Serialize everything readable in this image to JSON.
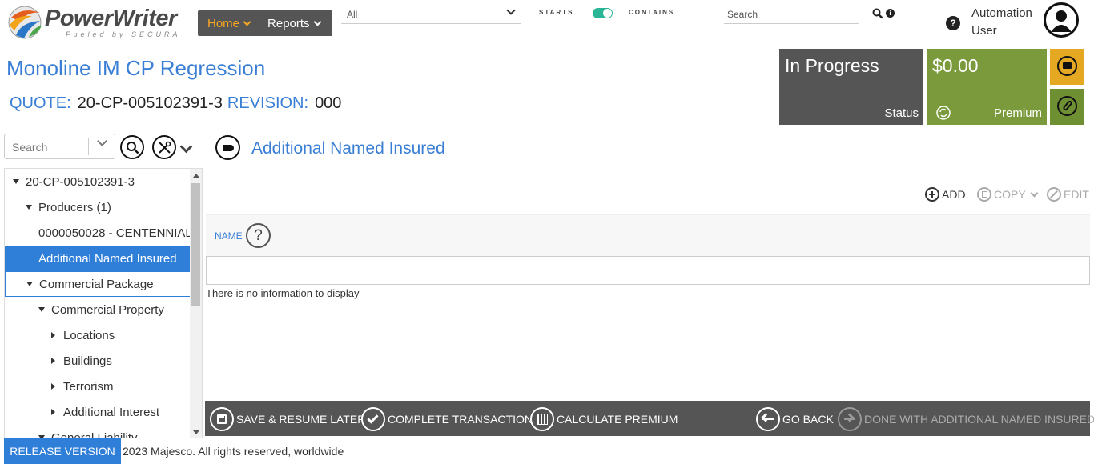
{
  "header": {
    "logo_text": "PowerWriter",
    "logo_tagline": "Fueled by SECURA",
    "nav": [
      {
        "label": "Home"
      },
      {
        "label": "Reports"
      }
    ],
    "scope_select_value": "All",
    "starts_label": "STARTS",
    "contains_label": "CONTAINS",
    "search_placeholder": "Search",
    "help_icon_text": "?",
    "info_icon_text": "i",
    "user": {
      "line1": "Automation",
      "line2": "User"
    }
  },
  "page": {
    "title": "Monoline IM CP Regression",
    "quote_label": "QUOTE:",
    "quote_value": "20-CP-005102391-3",
    "revision_label": "REVISION:",
    "revision_value": "000"
  },
  "tiles": {
    "status_value": "In Progress",
    "status_label": "Status",
    "premium_value": "$0.00",
    "premium_label": "Premium"
  },
  "tree_search": {
    "placeholder": "Search"
  },
  "tree": [
    {
      "label": "20-CP-005102391-3",
      "caret": "down",
      "level": 0
    },
    {
      "label": "Producers (1)",
      "caret": "down",
      "level": 1
    },
    {
      "label": "0000050028 - CENTENNIAL",
      "caret": "none",
      "level": 2
    },
    {
      "label": "Additional Named Insured",
      "caret": "none",
      "level": 1,
      "selected": true
    },
    {
      "label": "Commercial Package",
      "caret": "down",
      "level": 1,
      "outlined": true
    },
    {
      "label": "Commercial Property",
      "caret": "down",
      "level": 2
    },
    {
      "label": "Locations",
      "caret": "right",
      "level": 3
    },
    {
      "label": "Buildings",
      "caret": "right",
      "level": 3
    },
    {
      "label": "Terrorism",
      "caret": "right",
      "level": 3
    },
    {
      "label": "Additional Interest",
      "caret": "right",
      "level": 3
    },
    {
      "label": "General Liability",
      "caret": "down",
      "level": 2
    }
  ],
  "section": {
    "title": "Additional Named Insured",
    "actions": {
      "add": "ADD",
      "copy": "COPY",
      "edit": "EDIT"
    },
    "column_name": "NAME",
    "column_help": "?",
    "empty_message": "There is no information to display"
  },
  "action_bar": {
    "save": "SAVE & RESUME LATER",
    "complete": "COMPLETE TRANSACTION",
    "calculate": "CALCULATE PREMIUM",
    "go_back": "GO BACK",
    "done": "DONE WITH ADDITIONAL NAMED INSURED"
  },
  "footer": {
    "release_button": "RELEASE VERSION",
    "copyright": "2023 Majesco. All rights reserved, worldwide"
  },
  "colors": {
    "accent_blue": "#3a7fd5",
    "nav_bg": "#555555",
    "home_active": "#f5a623",
    "premium_green": "#7a9a3b",
    "notes_orange": "#e5a823",
    "toggle_teal": "#2bb597"
  }
}
